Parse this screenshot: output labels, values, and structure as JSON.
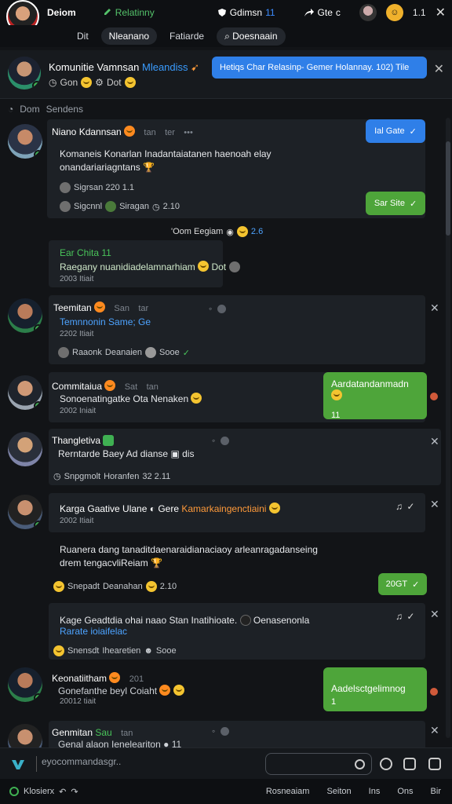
{
  "topbar": {
    "title": "Deiom",
    "tag": "Relatinny",
    "mid_label": "Gdimsn",
    "mid_num": "11",
    "share": "Gte",
    "share_suffix": "c",
    "count": "1.1"
  },
  "tabs": [
    {
      "label": "Dit"
    },
    {
      "label": "Nleanano"
    },
    {
      "label": "Fatiarde"
    },
    {
      "label": "Doesnaain"
    }
  ],
  "pinned": {
    "name": "Komunitie Vamnsan",
    "highlight": "Mleandiss",
    "sub_a": "Gon",
    "sub_b": "Dot",
    "banner": "Hetiqs Char Relasinp- Gemer Holannay. 102) Tile"
  },
  "section": {
    "label_a": "Dom",
    "label_b": "Sendens"
  },
  "posts": [
    {
      "name": "Niano Kdannsan",
      "meta": "tan",
      "meta2": "ter",
      "text1": "Komaneis Konarlan Inadantaiatanen haenoah elay",
      "text2": "onandariariagntans",
      "line1": "Sigrsan 220 1.1",
      "line2_a": "Sigcnnl",
      "line2_b": "Siragan",
      "line2_c": "2.10",
      "btn_blue": "Ial Gate",
      "btn_green": "Sar Site"
    },
    {
      "time_label": "'Oom Eegiam",
      "time_num": "2.6",
      "green_title": "Ear Chita 11",
      "text": "Raegany nuanidiadelamnarhiam",
      "text_suffix": "Dot",
      "time": "2003 Itiait"
    },
    {
      "name": "Teemitan",
      "meta": "San",
      "meta2": "tar",
      "link": "Temnnonin Same; Ge",
      "time": "2202 Itiait",
      "line_a": "Raaonk",
      "line_b": "Deanaien",
      "line_c": "Sooe"
    },
    {
      "name": "Commitaiua",
      "meta": "Sat",
      "meta2": "tan",
      "text": "Sonoenatingatke Ota Nenaken",
      "time": "2002 Iniait",
      "bubble": "Aardatandanmadn",
      "bubble_num": "11"
    },
    {
      "name": "Thangletiva",
      "text": "Rerntarde Baey Ad dianse",
      "text_suffix": "dis",
      "line_a": "Snpgmolt",
      "line_b": "Horanfen",
      "line_c": "32 2.11"
    },
    {
      "name": "Karga Gaative Ulane",
      "name_b": "Gere",
      "name_hl": "Kamarkaingenctiaini",
      "time": "2002 Itiait",
      "text1": "Ruanera dang tanaditdaenaraidianaciaoy arleanragadanseing",
      "text2": "drem tengacvliReiam",
      "line_a": "Snepadt",
      "line_b": "Deanahan",
      "line_c": "2.10",
      "btn_green": "20GT"
    },
    {
      "text": "Kage Geadtdia ohai naao Stan Inatihioate.",
      "text_hl": "Oenasenonla",
      "link": "Rarate ioiaifelac",
      "line_a": "Snensdt",
      "line_b": "Ihearetien",
      "line_c": "Sooe"
    },
    {
      "name": "Keonatiitham",
      "meta": "201",
      "text": "Gonefanthe beyl Coiaht",
      "time": "20012 tiait",
      "bubble": "Aadelsctgelimnog",
      "bubble_num": "1"
    },
    {
      "name": "Genmitan",
      "meta": "Sau",
      "meta2": "tan",
      "text": "Genal alaon Ieneleariton",
      "text_suffix": "11"
    }
  ],
  "composer": {
    "placeholder": "eyocommandasgr.."
  },
  "bottombar": {
    "left": "Klosierx",
    "items": [
      "Rosneaiam",
      "Seiton",
      "Ins",
      "Ons",
      "Bir"
    ]
  },
  "colors": {
    "accent_blue": "#2f7fe8",
    "accent_green": "#4ea53a",
    "bg": "#121417"
  }
}
